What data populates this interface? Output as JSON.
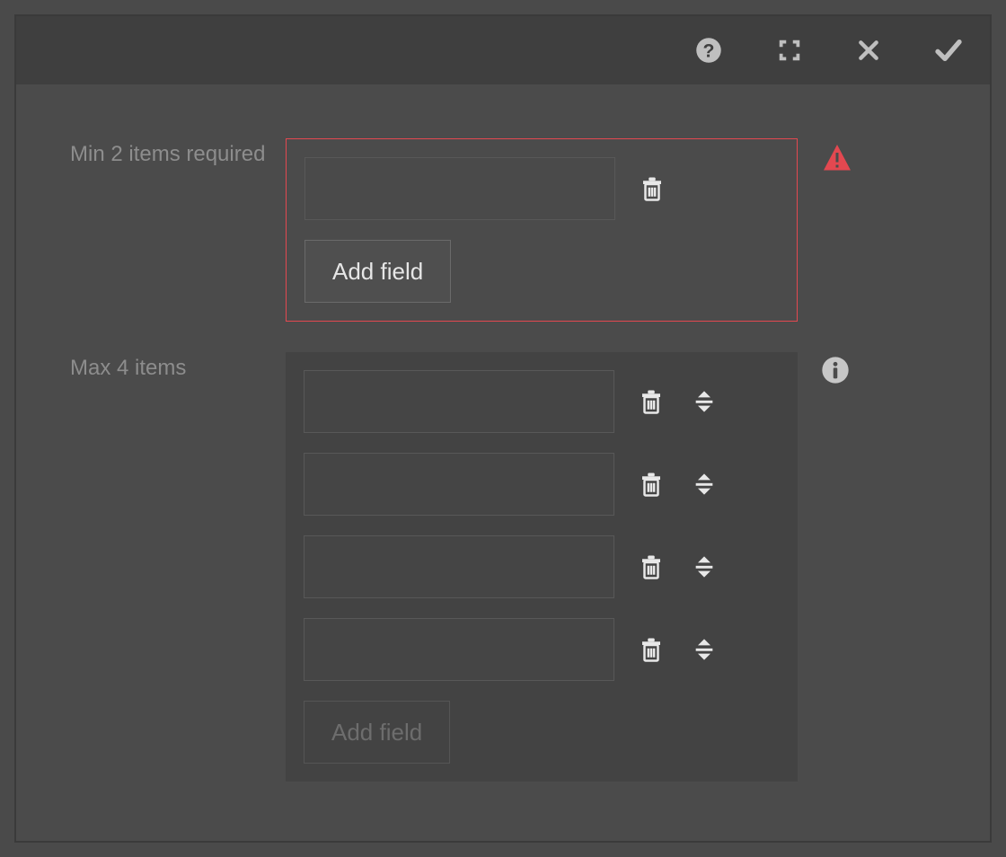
{
  "toolbar": {
    "help": "Help",
    "fullscreen": "Fullscreen",
    "close": "Close",
    "confirm": "Done"
  },
  "colors": {
    "error": "#e34850",
    "iconLight": "#e8e8e8",
    "iconMuted": "#9a9a9a"
  },
  "fields": [
    {
      "label": "Min 2 items required",
      "state": "error",
      "status_icon": "alert",
      "add_label": "Add field",
      "add_enabled": true,
      "items": [
        {
          "value": "",
          "reorder": false
        }
      ]
    },
    {
      "label": "Max 4 items",
      "state": "filled",
      "status_icon": "info",
      "add_label": "Add field",
      "add_enabled": false,
      "items": [
        {
          "value": "",
          "reorder": true
        },
        {
          "value": "",
          "reorder": true
        },
        {
          "value": "",
          "reorder": true
        },
        {
          "value": "",
          "reorder": true
        }
      ]
    }
  ]
}
